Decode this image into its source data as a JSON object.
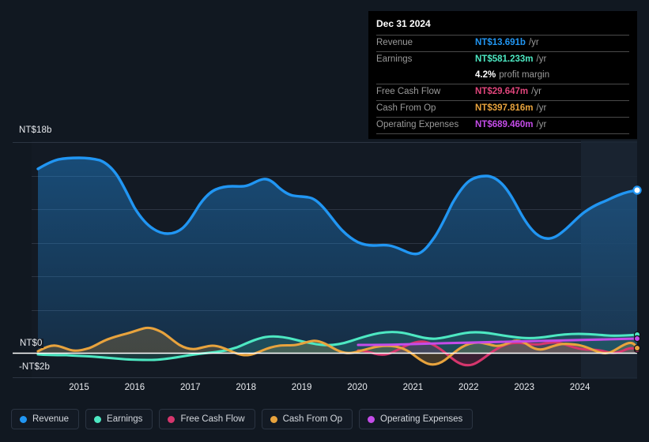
{
  "chart_data": {
    "type": "area",
    "title": "",
    "xlabel": "",
    "ylabel": "",
    "currency": "NT$",
    "grid": true,
    "legend_position": "bottom",
    "ylim": [
      -2,
      18
    ],
    "y_ticks": [
      18,
      0,
      -2
    ],
    "y_tick_labels": [
      "NT$18b",
      "NT$0",
      "-NT$2b"
    ],
    "x_tick_labels": [
      "2015",
      "2016",
      "2017",
      "2018",
      "2019",
      "2020",
      "2021",
      "2022",
      "2023",
      "2024"
    ],
    "x": [
      2014.4,
      2014.7,
      2015.0,
      2015.3,
      2015.6,
      2015.9,
      2016.2,
      2016.5,
      2016.8,
      2017.1,
      2017.4,
      2017.7,
      2018.0,
      2018.3,
      2018.6,
      2018.9,
      2019.2,
      2019.5,
      2019.8,
      2020.1,
      2020.4,
      2020.7,
      2021.0,
      2021.3,
      2021.6,
      2021.9,
      2022.2,
      2022.5,
      2022.8,
      2023.1,
      2023.4,
      2023.7,
      2024.0,
      2024.3,
      2024.6,
      2024.95
    ],
    "forecast_start_x": 2024.15,
    "series": [
      {
        "name": "Revenue",
        "color": "#2196f3",
        "unit": "b",
        "values": [
          15.6,
          16.3,
          16.5,
          16.5,
          16.3,
          15.2,
          13.6,
          12.4,
          11.7,
          11.5,
          12.0,
          13.1,
          13.6,
          13.7,
          14.0,
          13.7,
          13.2,
          12.6,
          11.8,
          11.3,
          11.2,
          10.9,
          11.1,
          12.2,
          14.1,
          15.5,
          15.6,
          14.9,
          13.2,
          11.9,
          11.4,
          12.0,
          12.6,
          13.1,
          13.4,
          13.691
        ]
      },
      {
        "name": "Earnings",
        "color": "#4de8c2",
        "unit": "m",
        "values": [
          -90,
          -110,
          -120,
          -125,
          -130,
          -140,
          -170,
          -210,
          -230,
          -225,
          -215,
          -190,
          -130,
          -60,
          20,
          90,
          190,
          300,
          400,
          470,
          480,
          420,
          330,
          250,
          180,
          130,
          180,
          320,
          450,
          530,
          500,
          430,
          380,
          420,
          500,
          581
        ]
      },
      {
        "name": "Free Cash Flow",
        "color": "#d6366d",
        "unit": "m",
        "values": [
          null,
          null,
          null,
          null,
          null,
          null,
          null,
          null,
          null,
          null,
          null,
          null,
          null,
          null,
          null,
          null,
          null,
          null,
          80,
          60,
          -30,
          20,
          140,
          260,
          300,
          250,
          60,
          -290,
          -420,
          -330,
          20,
          260,
          310,
          220,
          130,
          29.647
        ]
      },
      {
        "name": "Cash From Op",
        "color": "#e8a33d",
        "unit": "m",
        "values": [
          90,
          210,
          160,
          110,
          130,
          200,
          280,
          420,
          500,
          430,
          290,
          230,
          300,
          320,
          300,
          250,
          130,
          150,
          260,
          330,
          290,
          210,
          120,
          40,
          90,
          180,
          230,
          60,
          -260,
          -380,
          -260,
          140,
          330,
          420,
          300,
          397.816
        ]
      },
      {
        "name": "Operating Expenses",
        "color": "#c44ce8",
        "unit": "m",
        "values": [
          null,
          null,
          null,
          null,
          null,
          null,
          null,
          null,
          null,
          null,
          null,
          null,
          null,
          null,
          null,
          null,
          null,
          null,
          null,
          480,
          485,
          490,
          495,
          500,
          510,
          520,
          535,
          550,
          565,
          580,
          600,
          625,
          650,
          665,
          678,
          689.46
        ]
      }
    ]
  },
  "tooltip": {
    "title": "Dec 31 2024",
    "rows": [
      {
        "key": "Revenue",
        "value": "NT$13.691b",
        "unit": "/yr",
        "color": "#2196f3"
      },
      {
        "key": "Earnings",
        "value": "NT$581.233m",
        "unit": "/yr",
        "color": "#4de8c2"
      },
      {
        "key": "",
        "value": "4.2%",
        "unit": "profit margin",
        "color": "#ffffff"
      },
      {
        "key": "Free Cash Flow",
        "value": "NT$29.647m",
        "unit": "/yr",
        "color": "#e0457b"
      },
      {
        "key": "Cash From Op",
        "value": "NT$397.816m",
        "unit": "/yr",
        "color": "#e8a33d"
      },
      {
        "key": "Operating Expenses",
        "value": "NT$689.460m",
        "unit": "/yr",
        "color": "#c44ce8"
      }
    ]
  },
  "legend": {
    "items": [
      {
        "label": "Revenue",
        "color": "#2196f3"
      },
      {
        "label": "Earnings",
        "color": "#4de8c2"
      },
      {
        "label": "Free Cash Flow",
        "color": "#d6366d"
      },
      {
        "label": "Cash From Op",
        "color": "#e8a33d"
      },
      {
        "label": "Operating Expenses",
        "color": "#c44ce8"
      }
    ]
  },
  "colors": {
    "background": "#111821",
    "plot_background": "#131a24",
    "gridline": "#2c3542",
    "zero_line": "#ffffff",
    "forecast_band": "#1a2433"
  }
}
